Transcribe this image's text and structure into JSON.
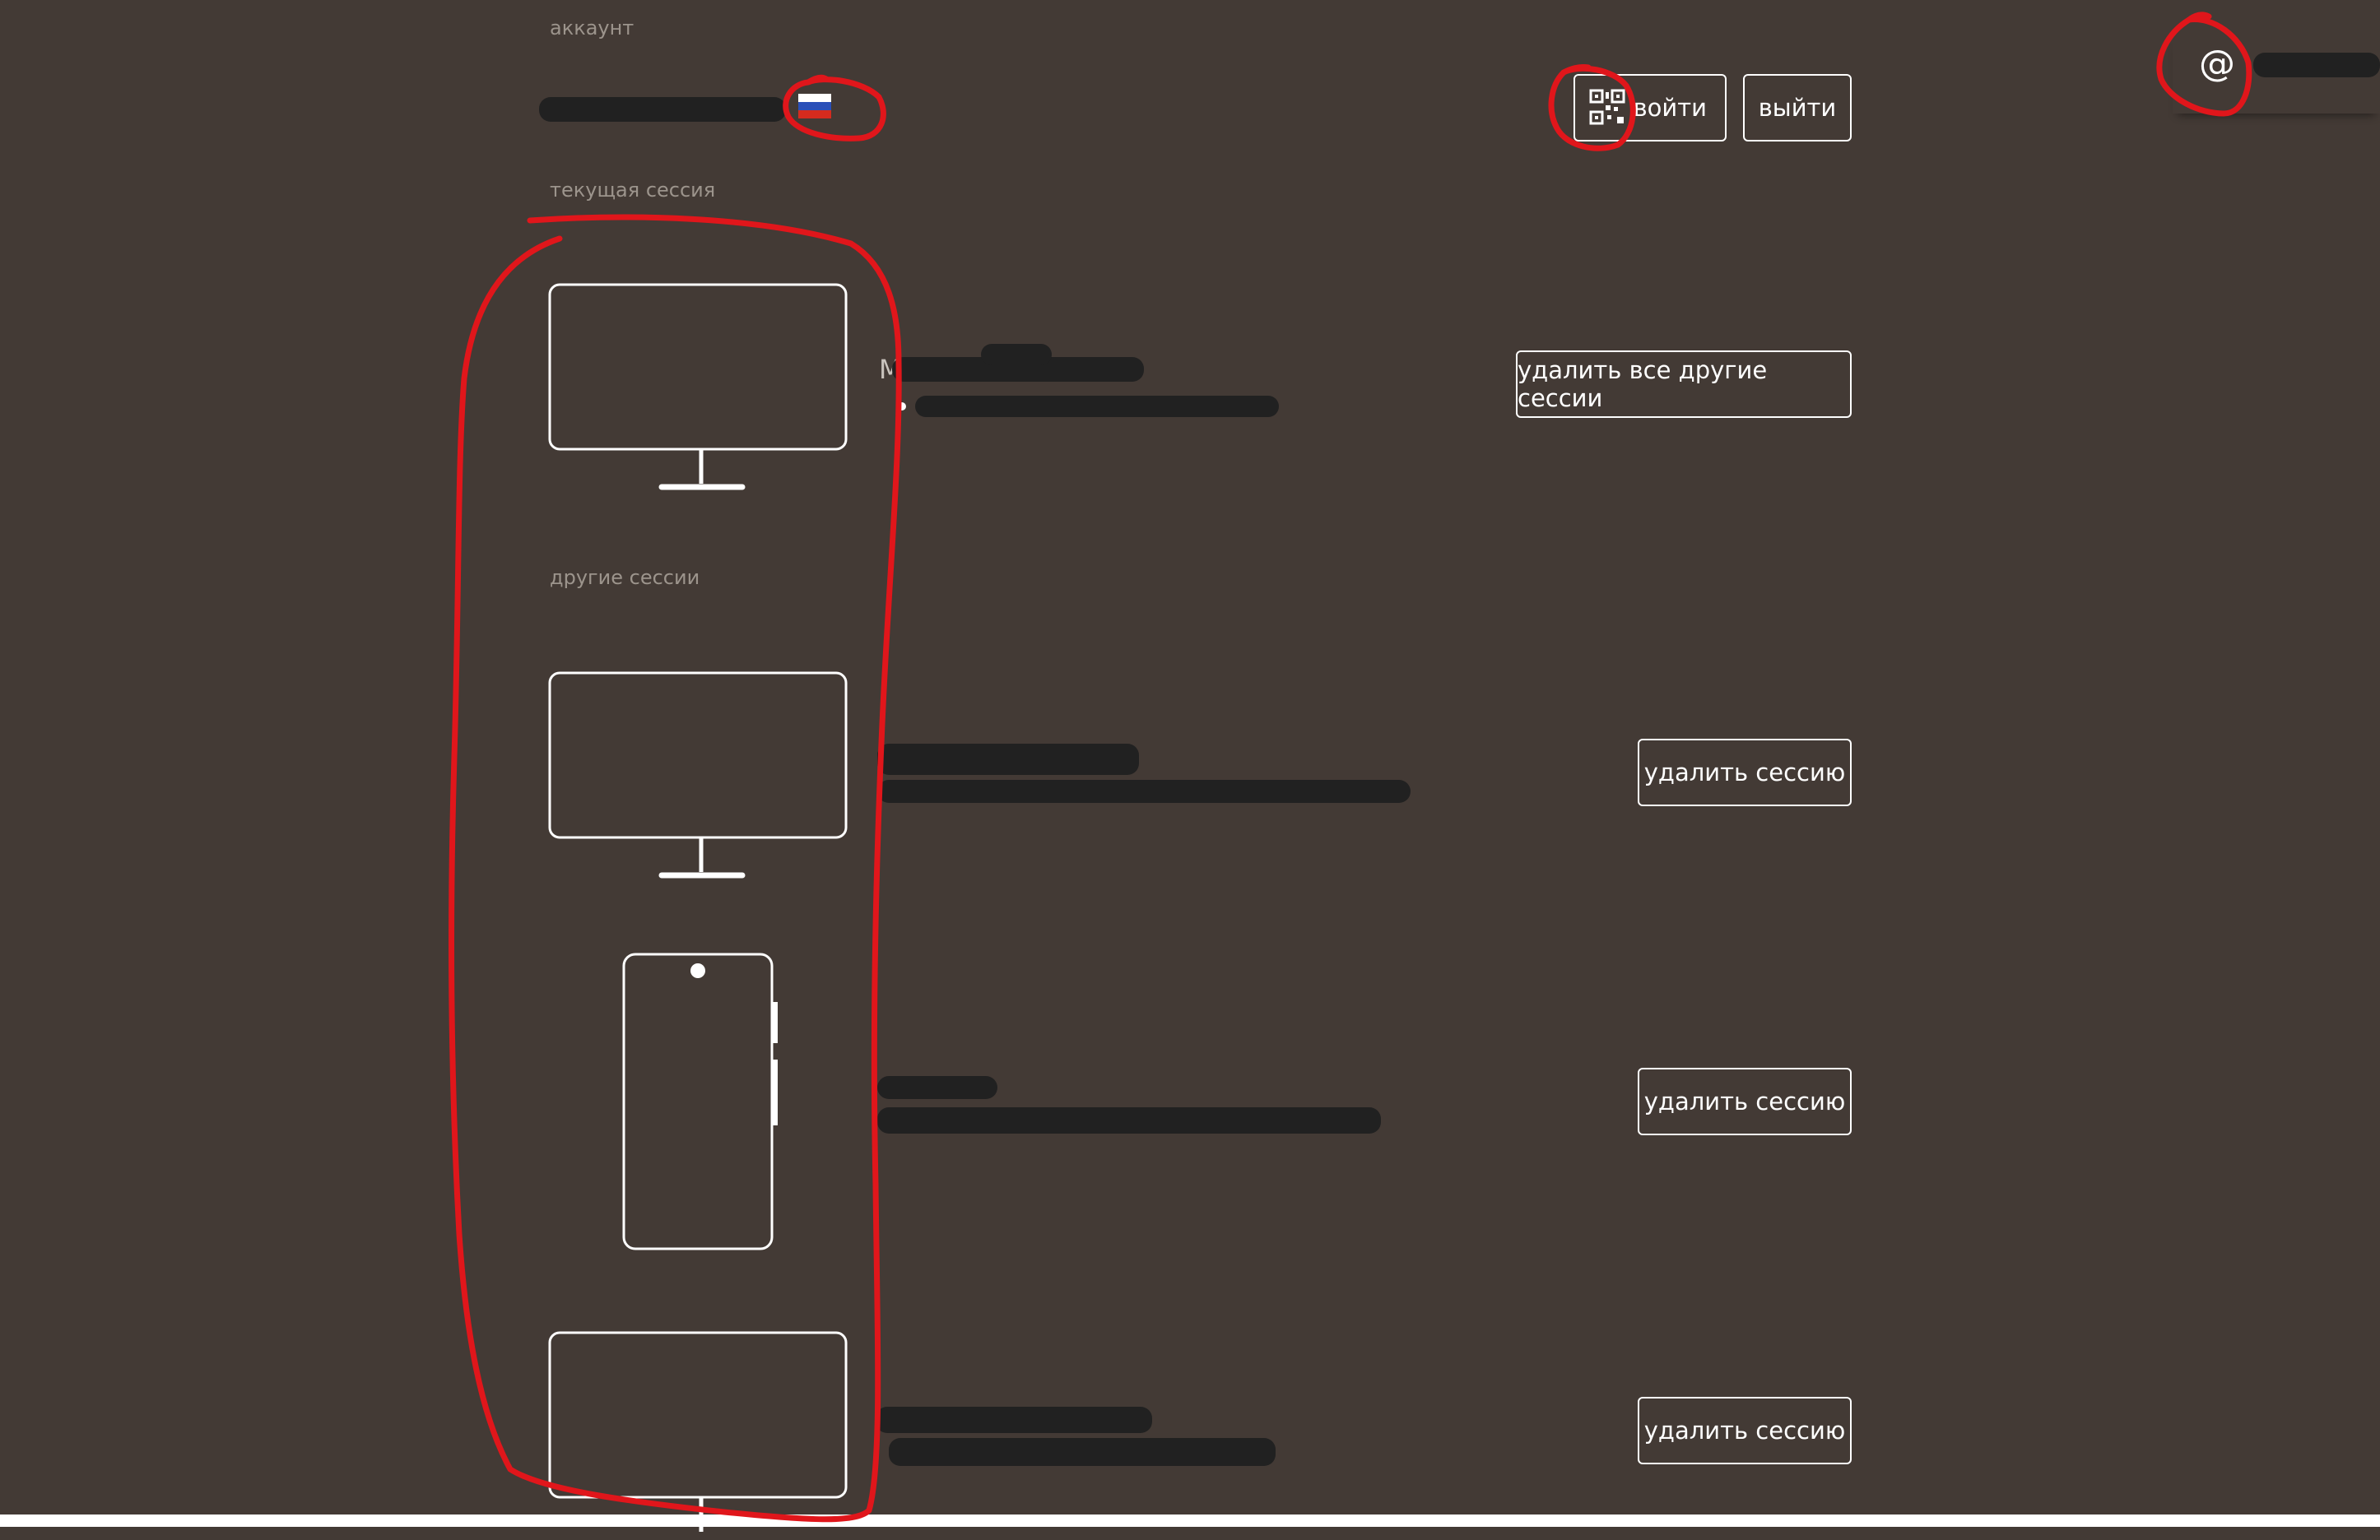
{
  "account": {
    "section_label": "аккаунт",
    "flag_icon": "russia-flag-icon",
    "login_button": {
      "icon": "qr-code-icon",
      "label": "войти"
    },
    "logout_label": "выйти"
  },
  "profile": {
    "icon": "at-sign-icon",
    "icon_glyph": "@"
  },
  "current_session": {
    "section_label": "текущая сессия",
    "device": "desktop-monitor-icon",
    "name_initial": "M",
    "delete_all_label": "удалить все другие сессии"
  },
  "other_sessions": {
    "section_label": "другие сессии",
    "items": [
      {
        "device": "desktop-monitor-icon",
        "delete_label": "удалить сессию"
      },
      {
        "device": "smartphone-icon",
        "delete_label": "удалить сессию"
      },
      {
        "device": "desktop-monitor-icon",
        "delete_label": "удалить сессию"
      }
    ]
  },
  "colors": {
    "background": "#433a35",
    "annotation_red": "#e0161b",
    "redaction": "#212121",
    "muted_label": "#9c948c"
  }
}
